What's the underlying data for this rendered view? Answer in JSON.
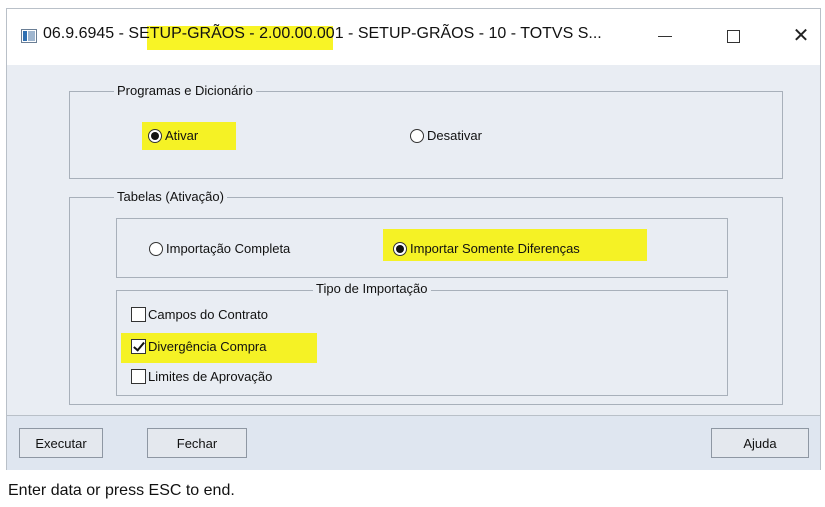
{
  "window": {
    "title": "06.9.6945 - SETUP-GRÃOS - 2.00.00.001 - SETUP-GRÃOS - 10 - TOTVS S...",
    "highlight_color": "#f7f200"
  },
  "programas": {
    "legend": "Programas e Dicionário",
    "options": [
      {
        "label": "Ativar",
        "selected": true
      },
      {
        "label": "Desativar",
        "selected": false
      }
    ]
  },
  "tabelas": {
    "legend": "Tabelas (Ativação)",
    "modes": [
      {
        "label": "Importação Completa",
        "selected": false
      },
      {
        "label": "Importar Somente Diferenças",
        "selected": true
      }
    ],
    "tipo": {
      "legend": "Tipo de Importação",
      "items": [
        {
          "label": "Campos do Contrato",
          "checked": false
        },
        {
          "label": "Divergência Compra",
          "checked": true
        },
        {
          "label": "Limites de Aprovação",
          "checked": false
        }
      ]
    }
  },
  "buttons": {
    "executar": "Executar",
    "fechar": "Fechar",
    "ajuda": "Ajuda"
  },
  "status": {
    "text": "Enter data or press ESC to end."
  }
}
